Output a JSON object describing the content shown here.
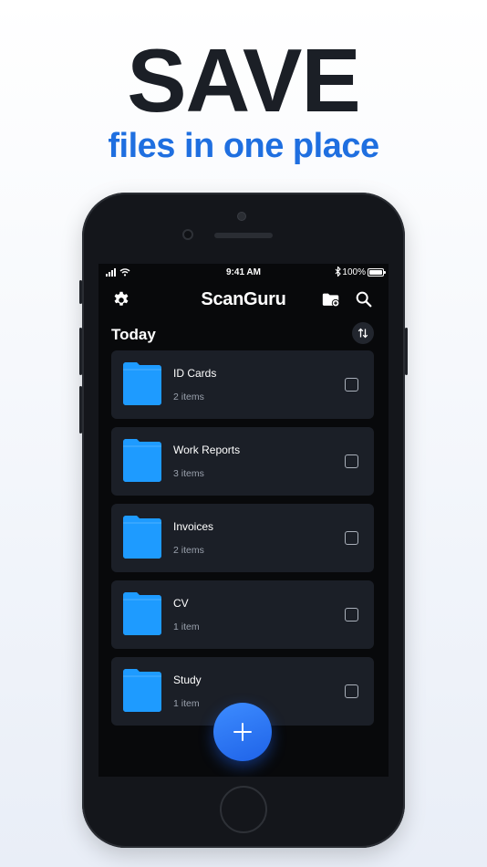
{
  "headline": "SAVE",
  "subheadline": "files in one place",
  "status_bar": {
    "time": "9:41 AM",
    "battery": "100%"
  },
  "app": {
    "title": "ScanGuru",
    "section_title": "Today"
  },
  "folders": [
    {
      "name": "ID Cards",
      "count": "2 items"
    },
    {
      "name": "Work Reports",
      "count": "3 items"
    },
    {
      "name": "Invoices",
      "count": "2 items"
    },
    {
      "name": "CV",
      "count": "1 item"
    },
    {
      "name": "Study",
      "count": "1 item"
    }
  ],
  "icons": {
    "settings": "gear-icon",
    "new_folder": "folder-add-icon",
    "search": "search-icon",
    "sort": "sort-arrows-icon",
    "add": "plus-icon"
  },
  "colors": {
    "accent": "#1f6fe0",
    "folder": "#1e9bff",
    "headline": "#1b1f26",
    "card": "#1b1f27"
  }
}
